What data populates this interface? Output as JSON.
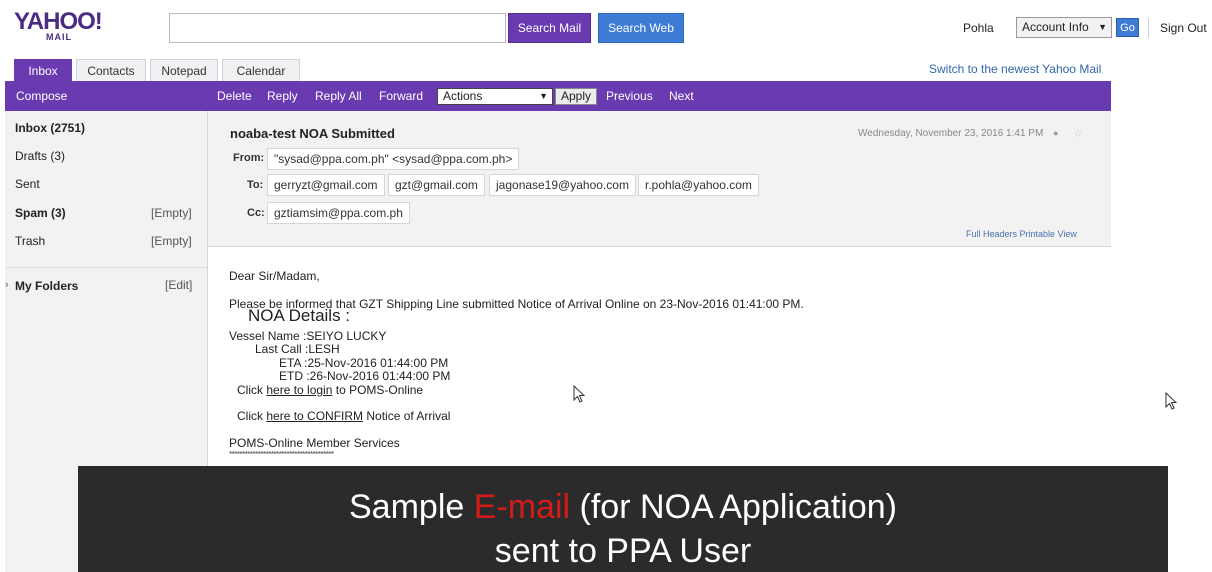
{
  "header": {
    "logo_text": "YAHOO!",
    "logo_sub": "MAIL",
    "search_placeholder": "",
    "search_mail_label": "Search Mail",
    "search_web_label": "Search Web",
    "user_name": "Pohla",
    "account_info_label": "Account Info",
    "go_label": "Go",
    "sign_out_label": "Sign Out"
  },
  "tabs": [
    {
      "label": "Inbox",
      "active": true
    },
    {
      "label": "Contacts",
      "active": false
    },
    {
      "label": "Notepad",
      "active": false
    },
    {
      "label": "Calendar",
      "active": false
    }
  ],
  "switch_link": "Switch to the newest Yahoo Mail",
  "toolbar": {
    "compose": "Compose",
    "delete": "Delete",
    "reply": "Reply",
    "reply_all": "Reply All",
    "forward": "Forward",
    "actions": "Actions",
    "apply": "Apply",
    "previous": "Previous",
    "next": "Next"
  },
  "sidebar": {
    "items": [
      {
        "label": "Inbox (2751)",
        "bold": true,
        "action": ""
      },
      {
        "label": "Drafts (3)",
        "bold": false,
        "action": ""
      },
      {
        "label": "Sent",
        "bold": false,
        "action": ""
      },
      {
        "label": "Spam (3)",
        "bold": true,
        "action": "[Empty]"
      },
      {
        "label": "Trash",
        "bold": false,
        "action": "[Empty]"
      }
    ],
    "my_folders": "My Folders",
    "my_folders_action": "[Edit]"
  },
  "message": {
    "subject": "noaba-test NOA Submitted",
    "date": "Wednesday, November 23, 2016 1:41 PM",
    "from_label": "From:",
    "from": "\"sysad@ppa.com.ph\" <sysad@ppa.com.ph>",
    "to_label": "To:",
    "to": [
      "gerryzt@gmail.com",
      "gzt@gmail.com",
      "jagonase19@yahoo.com",
      "r.pohla@yahoo.com"
    ],
    "cc_label": "Cc:",
    "cc": [
      "gztiamsim@ppa.com.ph"
    ],
    "header_links": "Full Headers  Printable View"
  },
  "body": {
    "greeting": "Dear Sir/Madam,",
    "intro": "Please be informed that GZT Shipping Line submitted Notice of Arrival Online on 23-Nov-2016 01:41:00 PM.",
    "noa_title": "NOA Details :",
    "vessel_line": "Vessel Name :SEIYO LUCKY",
    "last_call_line": "Last Call :LESH",
    "eta_line": "ETA :25-Nov-2016 01:44:00 PM",
    "etd_line": "ETD :26-Nov-2016 01:44:00 PM",
    "click_1_pre": "Click",
    "click_1_link": "here to login",
    "click_1_post": "to POMS-Online",
    "click_2_pre": "Click",
    "click_2_link": "here to CONFIRM",
    "click_2_post": "Notice of Arrival",
    "signature": "POMS-Online Member Services",
    "stars": "****************************************"
  },
  "caption": {
    "line1_pre": "Sample ",
    "line1_red": "E-mail",
    "line1_post": " (for NOA Application)",
    "line2": "sent to PPA User",
    "highlight_color": "#d61a1a"
  },
  "colors": {
    "yahoo_purple": "#6a3bb0",
    "search_web_blue": "#3d7bd4",
    "link_blue": "#3366aa"
  }
}
